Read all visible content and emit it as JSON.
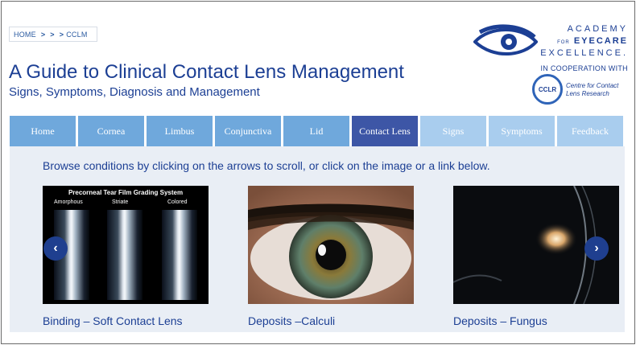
{
  "breadcrumb": {
    "home": "HOME",
    "sep1": ">",
    "sep2": ">",
    "sep3": ">",
    "current": "CCLM"
  },
  "page": {
    "title": "A Guide to Clinical Contact Lens Management",
    "subtitle": "Signs, Symptoms, Diagnosis and Management"
  },
  "logo": {
    "line1": "ACADEMY",
    "line2_prefix": "FOR",
    "line2": "EYECARE",
    "line3": "EXCELLENCE.",
    "cooperation": "IN COOPERATION WITH",
    "cclr_badge": "CCLR",
    "cclr_line1": "Centre for Contact",
    "cclr_line2": "Lens Research"
  },
  "nav": {
    "tabs": [
      {
        "label": "Home"
      },
      {
        "label": "Cornea"
      },
      {
        "label": "Limbus"
      },
      {
        "label": "Conjunctiva"
      },
      {
        "label": "Lid"
      },
      {
        "label": "Contact Lens"
      },
      {
        "label": "Signs"
      },
      {
        "label": "Symptoms"
      },
      {
        "label": "Feedback"
      }
    ],
    "active": "Contact Lens"
  },
  "main": {
    "instructions": "Browse conditions by clicking on the arrows to scroll, or click on the image or a link below.",
    "cards": [
      {
        "caption": "Binding – Soft Contact Lens",
        "image_title": "Precorneal Tear Film Grading System",
        "image_labels": [
          "Amorphous",
          "Striate",
          "Colored"
        ]
      },
      {
        "caption": "Deposits –Calculi"
      },
      {
        "caption": "Deposits – Fungus"
      }
    ],
    "prev_arrow": "‹",
    "next_arrow": "›"
  },
  "colors": {
    "brand_blue": "#1c3f94",
    "nav_tab": "#6fa8dc",
    "nav_active": "#3d56a6",
    "nav_light": "#a9cdee",
    "panel_bg": "#e9eef5"
  }
}
